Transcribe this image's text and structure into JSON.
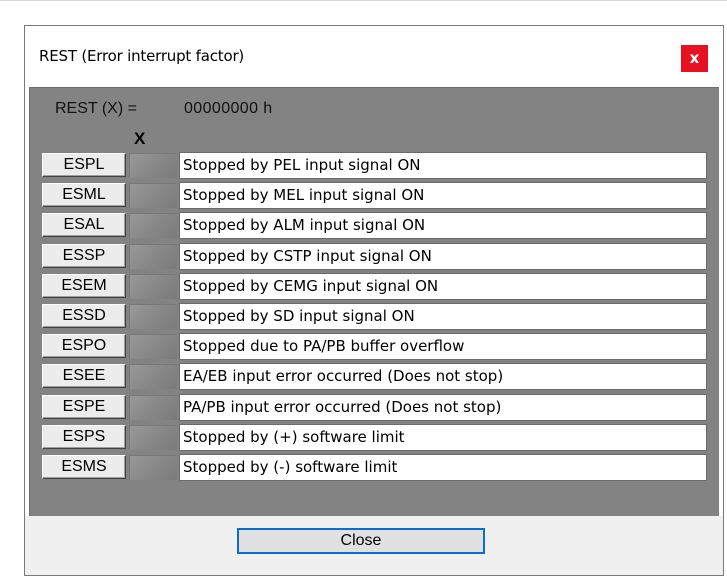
{
  "window": {
    "title": "REST (Error interrupt factor)",
    "close_glyph": "x"
  },
  "register": {
    "label": "REST (X) =",
    "value": "00000000 h",
    "column_header": "X"
  },
  "rows": [
    {
      "code": "ESPL",
      "description": "Stopped by PEL input signal ON"
    },
    {
      "code": "ESML",
      "description": "Stopped by MEL input signal ON"
    },
    {
      "code": "ESAL",
      "description": "Stopped by ALM input signal ON"
    },
    {
      "code": "ESSP",
      "description": "Stopped by CSTP input signal ON"
    },
    {
      "code": "ESEM",
      "description": "Stopped by CEMG input signal ON"
    },
    {
      "code": "ESSD",
      "description": "Stopped by SD input signal ON"
    },
    {
      "code": "ESPO",
      "description": "Stopped due to PA/PB buffer overflow"
    },
    {
      "code": "ESEE",
      "description": "EA/EB input error occurred (Does not stop)"
    },
    {
      "code": "ESPE",
      "description": "PA/PB input error occurred (Does not stop)"
    },
    {
      "code": "ESPS",
      "description": "Stopped by (+) software limit"
    },
    {
      "code": "ESMS",
      "description": "Stopped by (-) software limit"
    }
  ],
  "footer": {
    "close_label": "Close"
  },
  "colors": {
    "panel": "#838383",
    "close_button": "#e81123",
    "focus_border": "#0a6cd6"
  }
}
